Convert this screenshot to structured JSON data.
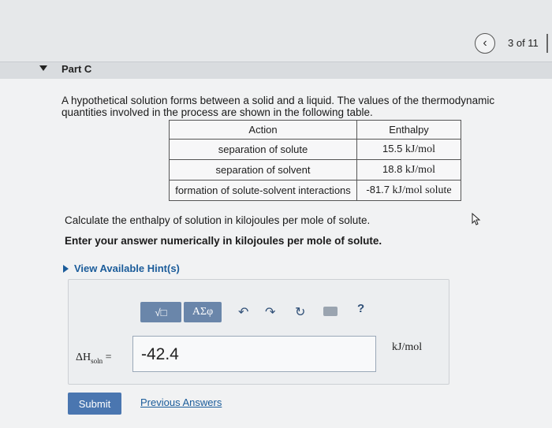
{
  "nav": {
    "page_counter": "3 of 11",
    "back_icon": "chevron-left-icon"
  },
  "part": {
    "title": "Part C"
  },
  "problem": {
    "text": "A hypothetical solution forms between a solid and a liquid. The values of the thermodynamic quantities involved in the process are shown in the following table."
  },
  "table": {
    "headers": [
      "Action",
      "Enthalpy"
    ],
    "rows": [
      {
        "action": "separation of solute",
        "value": "15.5",
        "unit": "kJ/mol"
      },
      {
        "action": "separation of solvent",
        "value": "18.8",
        "unit": "kJ/mol"
      },
      {
        "action": "formation of solute-solvent interactions",
        "value": "-81.7",
        "unit": "kJ/mol solute"
      }
    ]
  },
  "instructions": {
    "line1": "Calculate the enthalpy of solution in kilojoules per mole of solute.",
    "line2": "Enter your answer numerically in kilojoules per mole of solute."
  },
  "hints": {
    "label": "View Available Hint(s)"
  },
  "toolbar": {
    "templates_label": "√□",
    "symbols_label": "ΑΣφ",
    "undo_glyph": "↶",
    "redo_glyph": "↷",
    "reset_glyph": "↻",
    "help_glyph": "?"
  },
  "answer": {
    "variable": "ΔH",
    "variable_sub": "soln",
    "equals": "=",
    "value": "-42.4",
    "unit": "kJ/mol"
  },
  "actions": {
    "submit_label": "Submit",
    "previous_answers_label": "Previous Answers"
  },
  "colors": {
    "accent": "#4a76b0",
    "link": "#1b5c9a",
    "toolbar_button": "#6a86aa"
  }
}
